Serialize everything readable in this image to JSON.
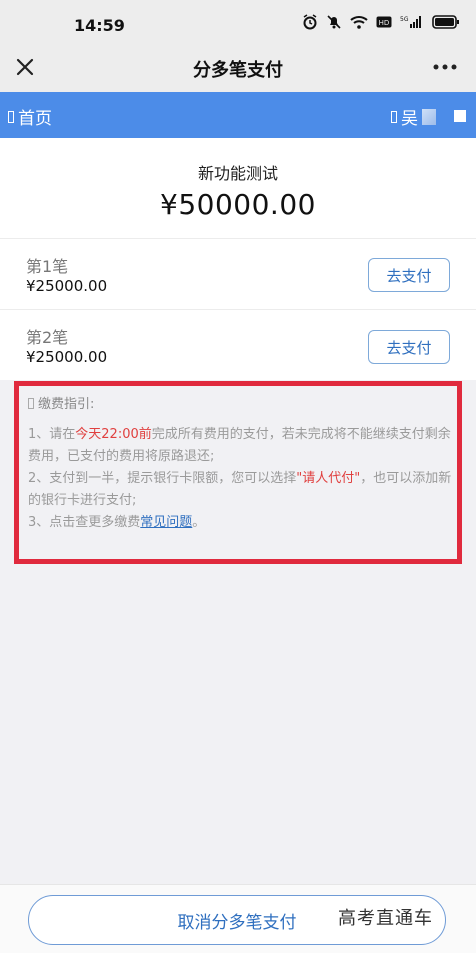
{
  "status": {
    "time": "14:59",
    "network": "5G"
  },
  "header": {
    "title": "分多笔支付"
  },
  "nav": {
    "home_label": "首页",
    "user_name": "吴"
  },
  "summary": {
    "title": "新功能测试",
    "amount": "¥50000.00"
  },
  "payments": [
    {
      "label": "第1笔",
      "amount": "¥25000.00",
      "button": "去支付"
    },
    {
      "label": "第2笔",
      "amount": "¥25000.00",
      "button": "去支付"
    }
  ],
  "guide": {
    "title": "缴费指引:",
    "line1_pre": "1、请在",
    "line1_highlight": "今天22:00前",
    "line1_post": "完成所有费用的支付，若未完成将不能继续支付剩余费用，已支付的费用将原路退还;",
    "line2_pre": "2、支付到一半，提示银行卡限额，您可以选择",
    "line2_highlight": "\"请人代付\"",
    "line2_post": "，也可以添加新的银行卡进行支付;",
    "line3_pre": "3、点击查更多缴费",
    "line3_link": "常见问题",
    "line3_post": "。"
  },
  "footer": {
    "cancel_label": "取消分多笔支付"
  },
  "watermark": "高考直通车",
  "colors": {
    "nav_blue": "#4c8ce8",
    "highlight_red": "#e0403f",
    "border_red": "#e02a3d",
    "link_blue": "#2f6fbf"
  }
}
